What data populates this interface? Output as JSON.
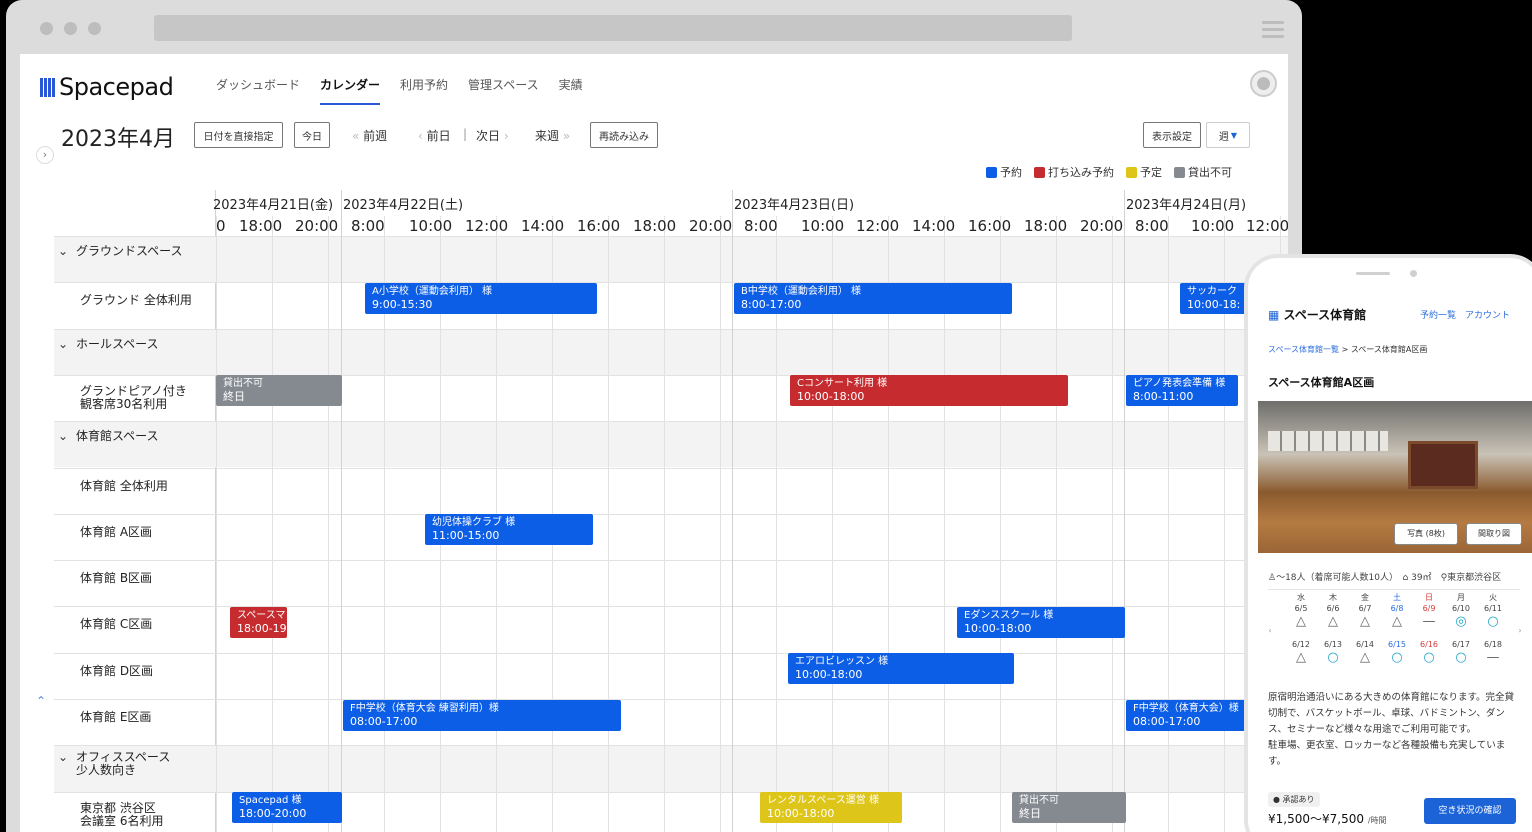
{
  "app": {
    "name": "Spacepad"
  },
  "nav": {
    "items": [
      "ダッシュボード",
      "カレンダー",
      "利用予約",
      "管理スペース",
      "実績"
    ],
    "active": "カレンダー"
  },
  "toolbar": {
    "month": "2023年4月",
    "date_direct": "日付を直接指定",
    "today": "今日",
    "prev_week": "前週",
    "prev_day": "前日",
    "separator": "|",
    "next_day": "次日",
    "next_week": "来週",
    "reload": "再読み込み",
    "display_settings": "表示設定",
    "view": "週"
  },
  "legend": [
    {
      "label": "予約",
      "color": "#0d5ee6"
    },
    {
      "label": "打ち込み予約",
      "color": "#c62c2f"
    },
    {
      "label": "予定",
      "color": "#ddc51a"
    },
    {
      "label": "貸出不可",
      "color": "#858a91"
    }
  ],
  "calendar": {
    "dates": [
      "2023年4月21日(金)",
      "2023年4月22日(土)",
      "2023年4月23日(日)",
      "2023年4月24日(月)"
    ],
    "times": [
      "0",
      "18:00",
      "20:00",
      "8:00",
      "10:00",
      "12:00",
      "14:00",
      "16:00",
      "18:00",
      "20:00",
      "8:00",
      "10:00",
      "12:00",
      "14:00",
      "16:00",
      "18:00",
      "20:00",
      "8:00",
      "10:00",
      "12:00"
    ],
    "rows": [
      {
        "type": "group",
        "label": "グラウンドスペース"
      },
      {
        "type": "resource",
        "label": "グラウンド 全体利用"
      },
      {
        "type": "group",
        "label": "ホールスペース"
      },
      {
        "type": "resource",
        "label": "グランドピアノ付き\n観客席30名利用"
      },
      {
        "type": "group",
        "label": "体育館スペース"
      },
      {
        "type": "resource",
        "label": "体育館 全体利用"
      },
      {
        "type": "resource",
        "label": "体育館 A区画"
      },
      {
        "type": "resource",
        "label": "体育館 B区画"
      },
      {
        "type": "resource",
        "label": "体育館 C区画"
      },
      {
        "type": "resource",
        "label": "体育館 D区画"
      },
      {
        "type": "resource",
        "label": "体育館 E区画"
      },
      {
        "type": "group",
        "label": "オフィススペース\n少人数向き"
      },
      {
        "type": "resource",
        "label": "東京都 渋谷区\n会議室 6名利用"
      }
    ],
    "events": [
      {
        "row": 1,
        "kind": "blue",
        "title": "A小学校（運動会利用） 様",
        "time": "9:00-15:30"
      },
      {
        "row": 1,
        "kind": "blue",
        "title": "B中学校（運動会利用） 様",
        "time": "8:00-17:00"
      },
      {
        "row": 1,
        "kind": "blue",
        "title": "サッカーク",
        "time": "10:00-18:"
      },
      {
        "row": 3,
        "kind": "gray",
        "title": "貸出不可",
        "time": "終日"
      },
      {
        "row": 3,
        "kind": "red",
        "title": "Cコンサート利用 様",
        "time": "10:00-18:00"
      },
      {
        "row": 3,
        "kind": "blue",
        "title": "ピアノ発表会準備 様",
        "time": "8:00-11:00"
      },
      {
        "row": 6,
        "kind": "blue",
        "title": "幼児体操クラブ 様",
        "time": "11:00-15:00"
      },
      {
        "row": 8,
        "kind": "red",
        "title": "スペースマ",
        "time": "18:00-19"
      },
      {
        "row": 8,
        "kind": "blue",
        "title": "Eダンススクール 様",
        "time": "10:00-18:00"
      },
      {
        "row": 9,
        "kind": "blue",
        "title": "エアロビレッスン 様",
        "time": "10:00-18:00"
      },
      {
        "row": 10,
        "kind": "blue",
        "title": "F中学校（体育大会 練習利用）様",
        "time": "08:00-17:00"
      },
      {
        "row": 10,
        "kind": "blue",
        "title": "F中学校（体育大会）様",
        "time": "08:00-17:00"
      },
      {
        "row": 12,
        "kind": "blue",
        "title": "Spacepad 様",
        "time": "18:00-20:00"
      },
      {
        "row": 12,
        "kind": "yellow",
        "title": "レンタルスペース運営 様",
        "time": "10:00-18:00"
      },
      {
        "row": 12,
        "kind": "gray",
        "title": "貸出不可",
        "time": "終日"
      }
    ]
  },
  "phone": {
    "title": "スペース体育館",
    "link_list": "予約一覧",
    "link_account": "アカウント",
    "breadcrumb_parent": "スペース体育館一覧",
    "breadcrumb_current": "スペース体育館A区画",
    "space_name": "スペース体育館A区画",
    "photo_button": "写真 (8枚)",
    "floorplan_button": "間取り図",
    "capacity": "〜18人（着席可能人数10人）",
    "area": "39㎡",
    "location": "東京都渋谷区",
    "weekdays": [
      "水",
      "木",
      "金",
      "土",
      "日",
      "月",
      "火"
    ],
    "week1_dates": [
      "6/5",
      "6/6",
      "6/7",
      "6/8",
      "6/9",
      "6/10",
      "6/11"
    ],
    "week1_marks": [
      "△",
      "△",
      "△",
      "△",
      "—",
      "◎",
      "○"
    ],
    "week2_dates": [
      "6/12",
      "6/13",
      "6/14",
      "6/15",
      "6/16",
      "6/17",
      "6/18"
    ],
    "week2_marks": [
      "△",
      "○",
      "△",
      "○",
      "○",
      "○",
      "—"
    ],
    "description": "原宿明治通沿いにある大きめの体育館になります。完全貸切制で、バスケットボール、卓球、バドミントン、ダンス、セミナーなど様々な用途でご利用可能です。\n駐車場、更衣室、ロッカーなど各種設備も充実しています。",
    "badge": "承認あり",
    "price": "¥1,500〜¥7,500",
    "price_unit": "/時間",
    "cta": "空き状況の確認"
  }
}
